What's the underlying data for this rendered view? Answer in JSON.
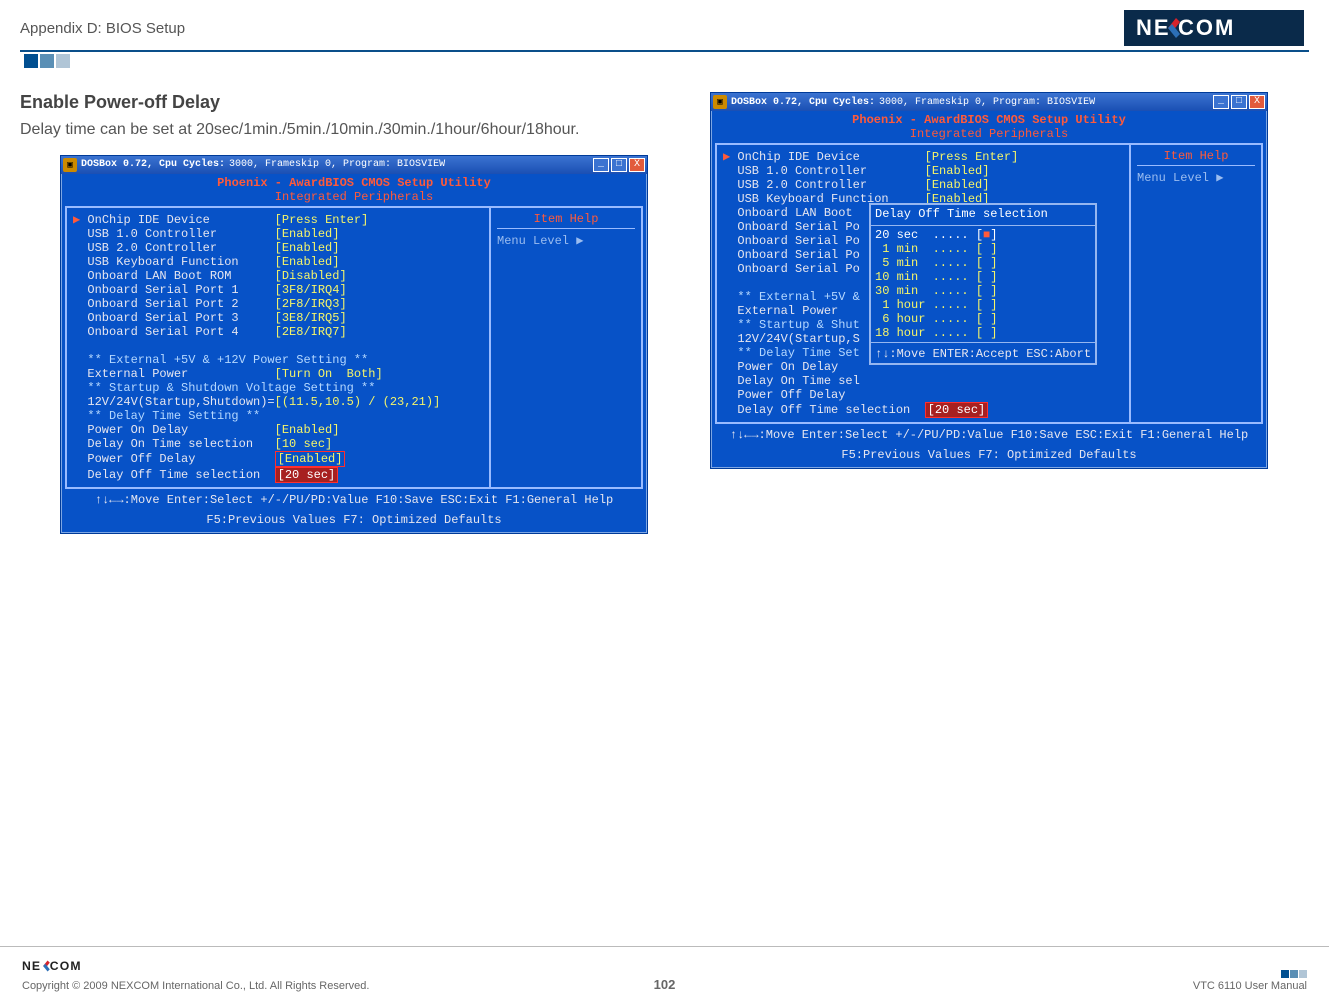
{
  "header": {
    "appendix": "Appendix D: BIOS Setup",
    "logo_text": "NEXCOM"
  },
  "section": {
    "heading": "Enable Power-off Delay",
    "body": "Delay time can be set at 20sec/1min./5min./10min./30min./1hour/6hour/18hour."
  },
  "bios_shared": {
    "titlebar_left": "DOSBox 0.72, Cpu Cycles:",
    "titlebar_right": "3000, Frameskip  0, Program:  BIOSVIEW",
    "title": "Phoenix - AwardBIOS CMOS Setup Utility",
    "subtitle": "Integrated Peripherals",
    "help_header": "Item Help",
    "help_menu_level": "Menu Level   ▶",
    "footer1": "↑↓←→:Move  Enter:Select  +/-/PU/PD:Value  F10:Save  ESC:Exit  F1:General Help",
    "footer2": "F5:Previous Values                F7: Optimized Defaults"
  },
  "left_bios": {
    "rows": [
      {
        "label": "OnChip IDE Device",
        "value": "[Press Enter]",
        "marker": "▶"
      },
      {
        "label": "USB 1.0 Controller",
        "value": "[Enabled]"
      },
      {
        "label": "USB 2.0 Controller",
        "value": "[Enabled]"
      },
      {
        "label": "USB Keyboard Function",
        "value": "[Enabled]"
      },
      {
        "label": "Onboard LAN Boot ROM",
        "value": "[Disabled]"
      },
      {
        "label": "Onboard Serial Port 1",
        "value": "[3F8/IRQ4]"
      },
      {
        "label": "Onboard Serial Port 2",
        "value": "[2F8/IRQ3]"
      },
      {
        "label": "Onboard Serial Port 3",
        "value": "[3E8/IRQ5]"
      },
      {
        "label": "Onboard Serial Port 4",
        "value": "[2E8/IRQ7]"
      },
      {
        "label": "",
        "value": ""
      },
      {
        "label": "** External +5V & +12V Power Setting **",
        "value": "",
        "hdr": true
      },
      {
        "label": "External Power",
        "value": "[Turn On  Both]"
      },
      {
        "label": "** Startup & Shutdown Voltage Setting **",
        "value": "",
        "hdr": true
      },
      {
        "label": "12V/24V(Startup,Shutdown)=",
        "value": "[(11.5,10.5) / (23,21)]"
      },
      {
        "label": "** Delay Time Setting **",
        "value": "",
        "hdr": true
      },
      {
        "label": "Power On Delay",
        "value": "[Enabled]"
      },
      {
        "label": "Delay On Time selection",
        "value": "[10 sec]"
      },
      {
        "label": "Power Off Delay",
        "value": "[Enabled]",
        "red": true
      },
      {
        "label": "Delay Off Time selection",
        "value": "[20 sec]",
        "red": true,
        "selected": true
      }
    ]
  },
  "right_bios": {
    "rows": [
      {
        "label": "OnChip IDE Device",
        "value": "[Press Enter]",
        "marker": "▶"
      },
      {
        "label": "USB 1.0 Controller",
        "value": "[Enabled]"
      },
      {
        "label": "USB 2.0 Controller",
        "value": "[Enabled]"
      },
      {
        "label": "USB Keyboard Function",
        "value": "[Enabled]"
      },
      {
        "label": "Onboard LAN Boot",
        "value": ""
      },
      {
        "label": "Onboard Serial Po",
        "value": ""
      },
      {
        "label": "Onboard Serial Po",
        "value": ""
      },
      {
        "label": "Onboard Serial Po",
        "value": ""
      },
      {
        "label": "Onboard Serial Po",
        "value": ""
      },
      {
        "label": "",
        "value": ""
      },
      {
        "label": "** External +5V &",
        "value": "",
        "hdr": true
      },
      {
        "label": "External Power",
        "value": ""
      },
      {
        "label": "** Startup & Shut",
        "value": "",
        "hdr": true
      },
      {
        "label": "12V/24V(Startup,S",
        "value": ""
      },
      {
        "label": "** Delay Time Set",
        "value": "",
        "hdr": true
      },
      {
        "label": "Power On Delay",
        "value": ""
      },
      {
        "label": "Delay On Time sel",
        "value": ""
      },
      {
        "label": "Power Off Delay",
        "value": ""
      },
      {
        "label": "Delay Off Time selection",
        "value": "[20 sec]",
        "red": true,
        "selected": true
      }
    ],
    "popup": {
      "title": "Delay Off Time selection",
      "options": [
        {
          "text": "20 sec  ..... [",
          "active": true,
          "sym": "■",
          "tail": "]"
        },
        {
          "text": " 1 min  ..... [ ]"
        },
        {
          "text": " 5 min  ..... [ ]"
        },
        {
          "text": "10 min  ..... [ ]"
        },
        {
          "text": "30 min  ..... [ ]"
        },
        {
          "text": " 1 hour ..... [ ]"
        },
        {
          "text": " 6 hour ..... [ ]"
        },
        {
          "text": "18 hour ..... [ ]"
        }
      ],
      "footer": "↑↓:Move ENTER:Accept ESC:Abort"
    }
  },
  "footer": {
    "copyright": "Copyright © 2009 NEXCOM International Co., Ltd. All Rights Reserved.",
    "page_number": "102",
    "manual": "VTC 6110 User Manual"
  }
}
